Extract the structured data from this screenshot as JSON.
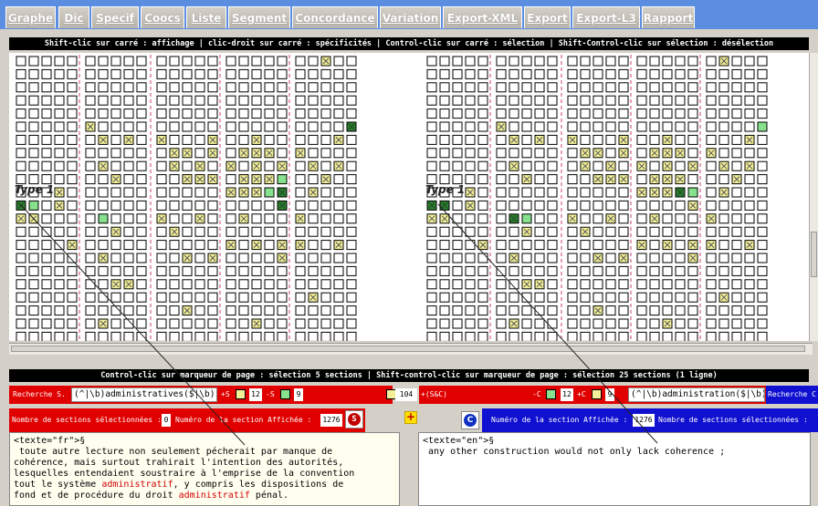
{
  "tabs": [
    "Graphe",
    "Dic",
    "Specif",
    "Coocs",
    "Liste",
    "Segment",
    "Concordance",
    "Variation",
    "Export-XML",
    "Export",
    "Export-L3",
    "Rapport"
  ],
  "top_instructions": "Shift-clic sur carré : affichage | clic-droit sur carré : spécificités | Control-clic sur carré : sélection | Shift-Control-clic sur sélection : désélection",
  "bottom_instructions": "Control-clic sur marqueur de page : sélection 5 sections | Shift-control-clic sur marqueur de page : sélection 25 sections (1 ligne)",
  "type_label": "Type 1",
  "search": {
    "left_label": "Recherche S.",
    "left_query": "(^|\\b)administratives($|\\b)|(^|\\b)a",
    "plus_s": "+S",
    "count_12": "12",
    "minus_s": "-S",
    "count_9": "9",
    "cooc_count": "104",
    "cooc_label": "+(S&C)",
    "minus_c": "-C",
    "count_12b": "12",
    "plus_c": "+C",
    "count_9b": "9",
    "right_query": "(^|\\b)administration($|\\b)|(^|\\b)ad",
    "right_label": "Recherche C."
  },
  "sections_left": {
    "label": "Nombre de sections sélectionnées :",
    "count": "0",
    "shown_label": "Numéro de la section Affichée :",
    "shown": "1276"
  },
  "sections_right": {
    "shown_label": "Numéro de la section Affichée :",
    "shown": "1276",
    "label": "Nombre de sections sélectionnées :"
  },
  "fr_text": {
    "tag": "<texte=\"fr\">§",
    "lines": [
      " toute autre lecture non seulement pécherait par manque de",
      "cohérence, mais surtout trahirait l'intention des autorités,",
      "lesquelles entendaient soustraire à l'emprise de la convention"
    ],
    "line4_a": "tout le système ",
    "line4_hl": "administratif",
    "line4_b": ", y compris les dispositions de",
    "line5_a": "fond et de procédure du droit ",
    "line5_hl": "administratif",
    "line5_b": " pénal."
  },
  "en_text": {
    "tag": "<texte=\"en\">§",
    "line1": " any other construction would not only lack coherence ;"
  },
  "icons": {
    "s_icon": "S",
    "c_icon": "C",
    "plus_icon": "+"
  },
  "colors": {
    "yellow": "#f2ef98",
    "green": "#2e7d32",
    "light_green": "#86e08c",
    "red": "#e00000",
    "blue": "#1010d0"
  }
}
